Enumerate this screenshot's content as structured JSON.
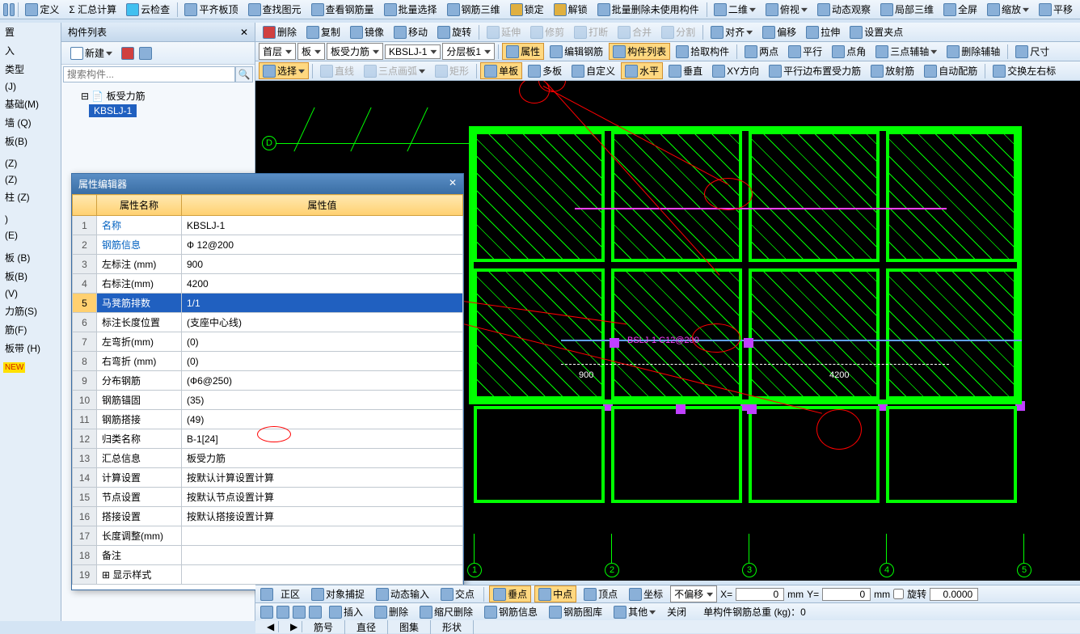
{
  "toolbar1": {
    "define": "定义",
    "sigma": "Σ 汇总计算",
    "cloud": "云检查",
    "align": "平齐板顶",
    "find": "查找图元",
    "rebar": "查看钢筋量",
    "batch_sel": "批量选择",
    "rebar3d": "钢筋三维",
    "lock": "锁定",
    "unlock": "解锁",
    "batch_del": "批量删除未使用构件",
    "v2d": "二维",
    "persp": "俯视",
    "dyn": "动态观察",
    "local3d": "局部三维",
    "full": "全屏",
    "zoom": "缩放",
    "pan": "平移"
  },
  "toolbar2": {
    "del": "删除",
    "copy": "复制",
    "mirror": "镜像",
    "move": "移动",
    "rotate": "旋转",
    "extend": "延伸",
    "trim": "修剪",
    "break": "打断",
    "merge": "合并",
    "split": "分割",
    "align": "对齐",
    "offset": "偏移",
    "stretch": "拉伸",
    "grip": "设置夹点"
  },
  "toolbar3": {
    "floor": "首层",
    "comp": "板",
    "rebar_type": "板受力筋",
    "member": "KBSLJ-1",
    "layer": "分层板1",
    "props": "属性",
    "edit_rebar": "编辑钢筋",
    "comp_list": "构件列表",
    "pick": "拾取构件",
    "two_pt": "两点",
    "parallel": "平行",
    "pt_angle": "点角",
    "three_aux": "三点辅轴",
    "del_aux": "删除辅轴",
    "size": "尺寸"
  },
  "toolbar4": {
    "select": "选择",
    "line": "直线",
    "arc": "三点画弧",
    "rect": "矩形",
    "single": "单板",
    "multi": "多板",
    "custom": "自定义",
    "horiz": "水平",
    "vert": "垂直",
    "xy": "XY方向",
    "par_rebar": "平行边布置受力筋",
    "radial": "放射筋",
    "auto": "自动配筋",
    "swap": "交换左右标"
  },
  "panel": {
    "title": "构件列表",
    "new": "新建",
    "search_ph": "搜索构件..."
  },
  "tree": {
    "root": "板受力筋",
    "item1": "KBSLJ-1"
  },
  "left_categories": [
    "置",
    "入",
    "类型",
    "(J)",
    "基础(M)",
    "墙 (Q)",
    "板(B)",
    "",
    "(Z)",
    "(Z)",
    "柱 (Z)",
    "",
    ")",
    "(E)",
    "",
    "板 (B)",
    "板(B)",
    "(V)",
    "力筋(S)",
    "筋(F)",
    "板带 (H)"
  ],
  "dialog": {
    "title": "属性编辑器",
    "col1": "属性名称",
    "col2": "属性值",
    "rows": [
      {
        "i": "1",
        "n": "名称",
        "v": "KBSLJ-1",
        "link": true
      },
      {
        "i": "2",
        "n": "钢筋信息",
        "v": "Ф 12@200",
        "link": true
      },
      {
        "i": "3",
        "n": "左标注 (mm)",
        "v": "900"
      },
      {
        "i": "4",
        "n": "右标注(mm)",
        "v": "4200"
      },
      {
        "i": "5",
        "n": "马凳筋排数",
        "v": "1/1",
        "sel": true
      },
      {
        "i": "6",
        "n": "标注长度位置",
        "v": "(支座中心线)"
      },
      {
        "i": "7",
        "n": "左弯折(mm)",
        "v": "(0)"
      },
      {
        "i": "8",
        "n": "右弯折 (mm)",
        "v": "(0)"
      },
      {
        "i": "9",
        "n": "分布钢筋",
        "v": "(Ф6@250)"
      },
      {
        "i": "10",
        "n": "钢筋锚固",
        "v": "(35)"
      },
      {
        "i": "11",
        "n": "钢筋搭接",
        "v": "(49)"
      },
      {
        "i": "12",
        "n": "归类名称",
        "v": "B-1[24]"
      },
      {
        "i": "13",
        "n": "汇总信息",
        "v": "板受力筋"
      },
      {
        "i": "14",
        "n": "计算设置",
        "v": "按默认计算设置计算"
      },
      {
        "i": "15",
        "n": "节点设置",
        "v": "按默认节点设置计算"
      },
      {
        "i": "16",
        "n": "搭接设置",
        "v": "按默认搭接设置计算"
      },
      {
        "i": "17",
        "n": "长度调整(mm)",
        "v": ""
      },
      {
        "i": "18",
        "n": "备注",
        "v": ""
      },
      {
        "i": "19",
        "n": "显示样式",
        "v": "",
        "exp": true
      }
    ]
  },
  "canvas": {
    "axis_d": "D",
    "axes_bottom": [
      "1",
      "2",
      "3",
      "4",
      "5"
    ],
    "rebar_label": "BSLJ-1 C12@200",
    "dim_left": "900",
    "dim_right": "4200"
  },
  "status2": {
    "redo": "正区",
    "snap": "对象捕捉",
    "dyn": "动态输入",
    "cross": "交点",
    "perp": "垂点",
    "mid": "中点",
    "top": "顶点",
    "coord": "坐标",
    "offset_mode": "不偏移",
    "x": "X=",
    "xv": "0",
    "y": "Y=",
    "yv": "0",
    "mm": "mm",
    "rot": "旋转",
    "rotv": "0.0000"
  },
  "status1": {
    "ins": "插入",
    "del": "删除",
    "scale": "缩尺删除",
    "info": "钢筋信息",
    "lib": "钢筋图库",
    "other": "其他",
    "close": "关闭",
    "weight": "单构件钢筋总重 (kg)：0"
  },
  "tabs": [
    "筋号",
    "直径",
    "图集",
    "形状"
  ]
}
